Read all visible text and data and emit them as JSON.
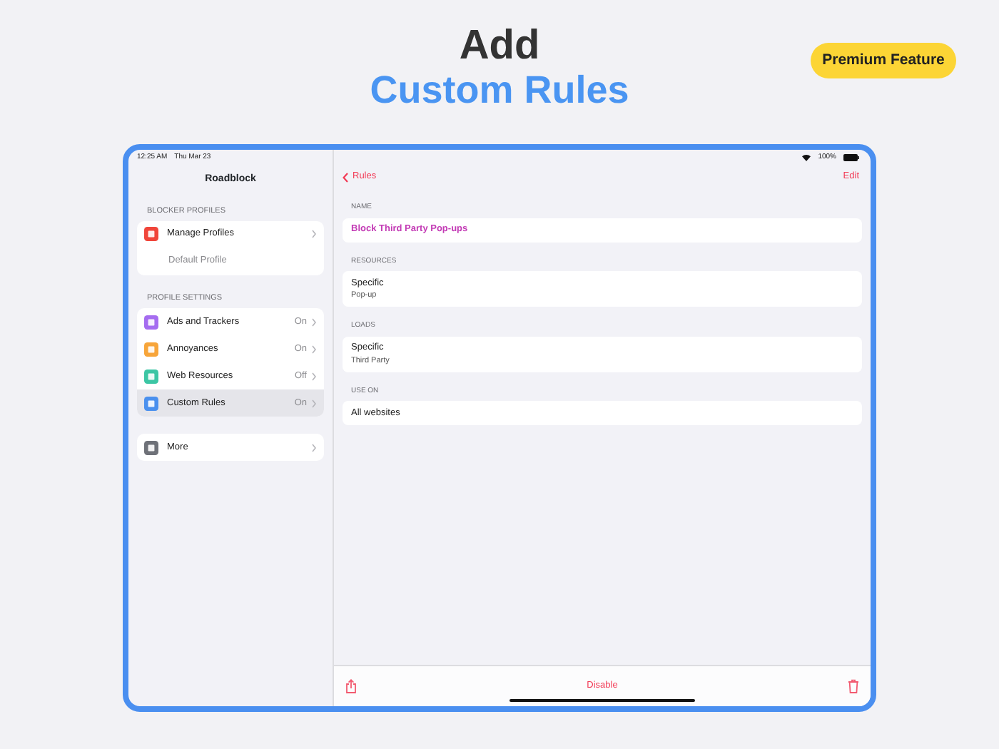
{
  "hero": {
    "title": "Add",
    "subtitle": "Custom Rules",
    "badge": "Premium Feature"
  },
  "status_bar": {
    "time": "12:25 AM",
    "date": "Thu Mar 23",
    "battery": "100%"
  },
  "sidebar": {
    "title": "Roadblock",
    "sections": [
      {
        "header": "BLOCKER PROFILES",
        "items": [
          {
            "kind": "icon",
            "label": "Manage Profiles",
            "color": "#f0453a",
            "selected": false
          },
          {
            "kind": "sub",
            "label": "Default Profile",
            "selected": false
          }
        ]
      },
      {
        "header": "PROFILE SETTINGS",
        "items": [
          {
            "kind": "icon",
            "label": "Ads and Trackers",
            "value": "On",
            "color": "#a56cf0",
            "selected": false
          },
          {
            "kind": "icon",
            "label": "Annoyances",
            "value": "On",
            "color": "#f7a53a",
            "selected": false
          },
          {
            "kind": "icon",
            "label": "Web Resources",
            "value": "Off",
            "color": "#3cc6a4",
            "selected": false
          },
          {
            "kind": "icon",
            "label": "Custom Rules",
            "value": "On",
            "color": "#4a90ee",
            "selected": true
          }
        ]
      },
      {
        "items": [
          {
            "kind": "icon",
            "label": "More",
            "color": "#6e7178",
            "selected": false
          }
        ]
      }
    ]
  },
  "detail": {
    "back": "Rules",
    "action": "Edit",
    "sections": [
      {
        "header": "NAME",
        "kind": "accent",
        "title": "Block Third Party Pop-ups"
      },
      {
        "header": "RESOURCES",
        "kind": "pair",
        "title": "Specific",
        "subtitle": "Pop-up"
      },
      {
        "header": "LOADS",
        "kind": "pair",
        "title": "Specific",
        "subtitle": "Third Party"
      },
      {
        "header": "USE ON",
        "kind": "plain",
        "title": "All websites"
      }
    ],
    "toolbar": {
      "center": "Disable"
    }
  }
}
